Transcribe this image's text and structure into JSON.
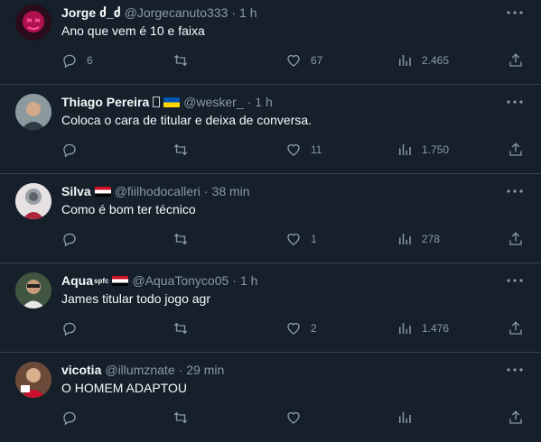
{
  "colors": {
    "background": "#15202b",
    "text": "#f7f9f9",
    "secondary": "#8b98a5",
    "divider": "#38444d"
  },
  "tweets": [
    {
      "name": "Jorge ძ_ძ",
      "handle": "@Jorgecanuto333",
      "separator": "·",
      "time": "1 h",
      "text": "Ano que vem é 10 e faixa",
      "replies": "6",
      "retweets": "",
      "likes": "67",
      "views": "2.465"
    },
    {
      "name": "Thiago Pereira",
      "handle": "@wesker_",
      "separator": "·",
      "time": "1 h",
      "text": "Coloca o cara de titular e deixa de conversa.",
      "replies": "",
      "retweets": "",
      "likes": "11",
      "views": "1.750"
    },
    {
      "name": "Silva",
      "handle": "@fiilhodocalleri",
      "separator": "·",
      "time": "38 min",
      "text": "Como é bom ter técnico",
      "replies": "",
      "retweets": "",
      "likes": "1",
      "views": "278"
    },
    {
      "name": "Aqua",
      "name_badge": "spfc",
      "handle": "@AquaTonyco05",
      "separator": "·",
      "time": "1 h",
      "text": "James titular todo jogo agr",
      "replies": "",
      "retweets": "",
      "likes": "2",
      "views": "1.476"
    },
    {
      "name": "vicotia",
      "handle": "@illumznate",
      "separator": "·",
      "time": "29 min",
      "text": "O HOMEM ADAPTOU",
      "replies": "",
      "retweets": "",
      "likes": "",
      "views": ""
    }
  ],
  "icons": {
    "reply": "reply-icon",
    "retweet": "retweet-icon",
    "like": "heart-icon",
    "views": "views-chart-icon",
    "share": "share-icon",
    "more": "more-dots-icon"
  }
}
